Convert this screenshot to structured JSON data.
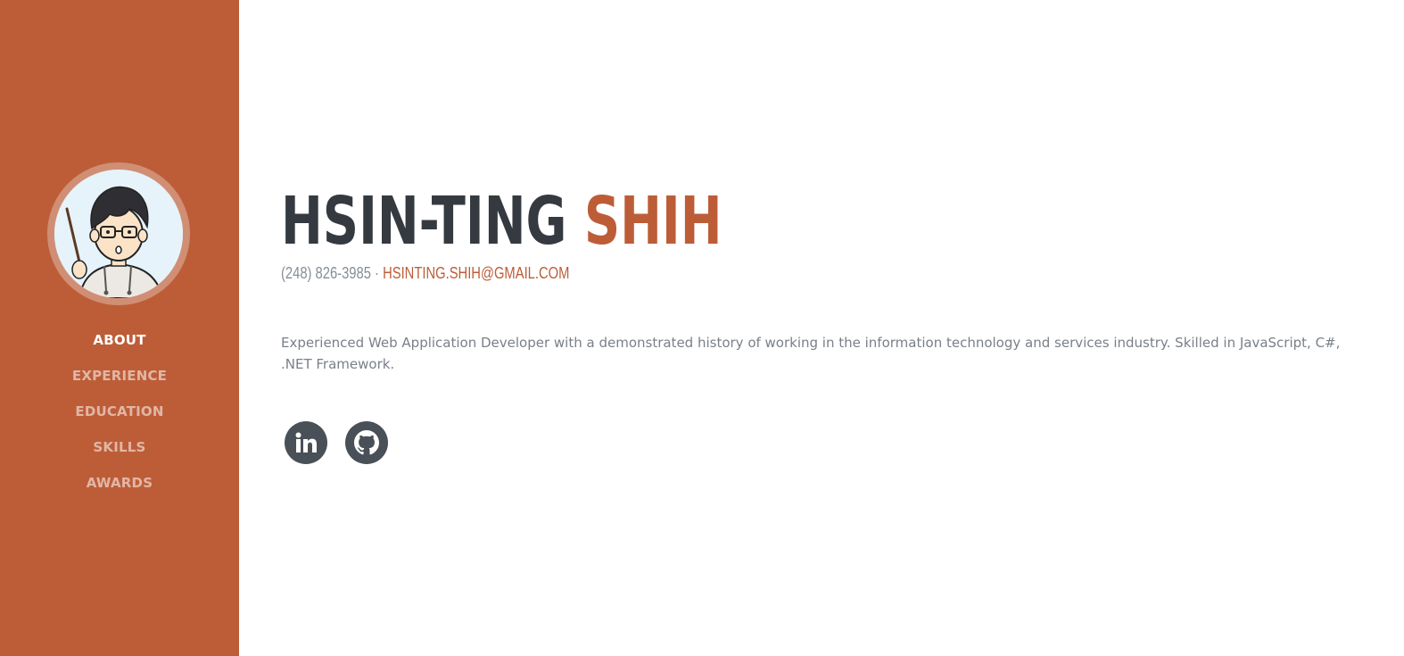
{
  "sidebar": {
    "avatar_alt": "profile avatar illustration",
    "nav": [
      {
        "label": "ABOUT",
        "active": true
      },
      {
        "label": "EXPERIENCE",
        "active": false
      },
      {
        "label": "EDUCATION",
        "active": false
      },
      {
        "label": "SKILLS",
        "active": false
      },
      {
        "label": "AWARDS",
        "active": false
      }
    ]
  },
  "about": {
    "first_name": "HSIN-TING",
    "last_name": "SHIH",
    "phone": "(248) 826-3985",
    "separator": "·",
    "email": "HSINTING.SHIH@GMAIL.COM",
    "summary": "Experienced Web Application Developer with a demonstrated history of working in the information technology and services industry. Skilled in JavaScript, C#, .NET Framework."
  },
  "social": [
    {
      "icon": "linkedin-icon"
    },
    {
      "icon": "github-icon"
    }
  ],
  "colors": {
    "primary": "#bd5d38",
    "dark": "#343a40",
    "muted": "#868e96",
    "icon_bg": "#495057"
  }
}
